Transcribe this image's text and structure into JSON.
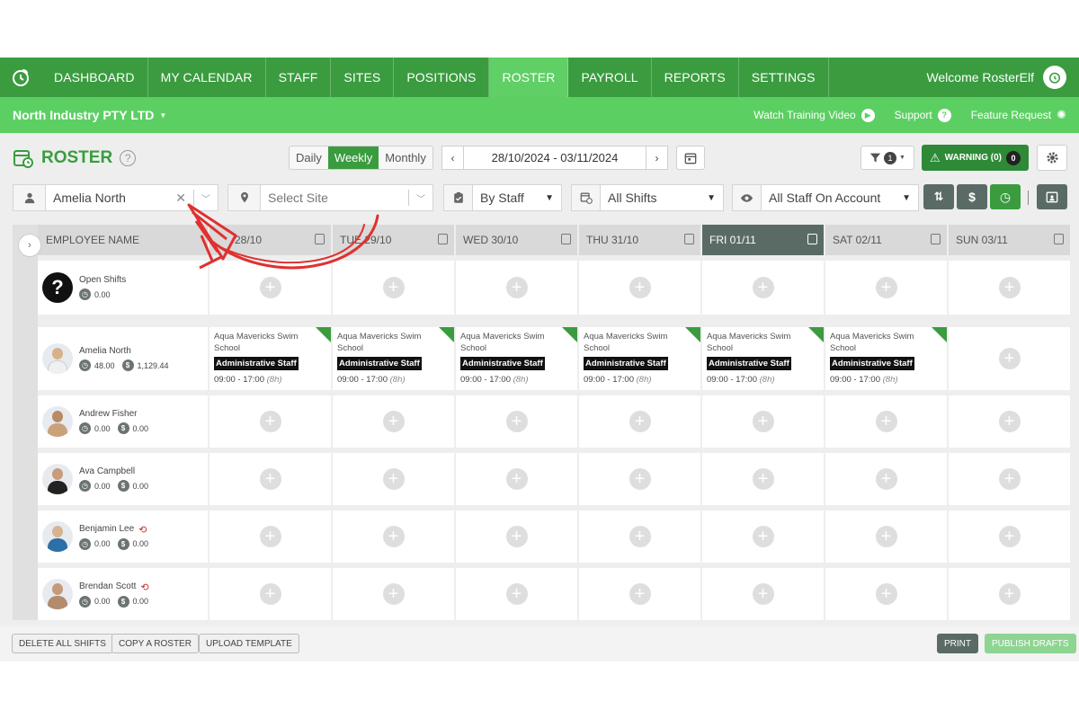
{
  "nav": {
    "items": [
      "DASHBOARD",
      "MY CALENDAR",
      "STAFF",
      "SITES",
      "POSITIONS",
      "ROSTER",
      "PAYROLL",
      "REPORTS",
      "SETTINGS"
    ],
    "active": "ROSTER",
    "welcome": "Welcome RosterElf"
  },
  "subbar": {
    "company": "North Industry PTY LTD",
    "watch": "Watch Training Video",
    "support": "Support",
    "feature": "Feature Request"
  },
  "roster": {
    "title": "ROSTER",
    "views": [
      "Daily",
      "Weekly",
      "Monthly"
    ],
    "active_view": "Weekly",
    "date_range": "28/10/2024 - 03/11/2024",
    "filter_count": "1",
    "warning_label": "WARNING (0)",
    "warning_count": "0"
  },
  "filters": {
    "employee": "Amelia North",
    "site_placeholder": "Select Site",
    "group_by": "By Staff",
    "shifts": "All Shifts",
    "visibility": "All Staff On Account"
  },
  "grid": {
    "employee_header": "EMPLOYEE NAME",
    "days": [
      "MON 28/10",
      "TUE 29/10",
      "WED 30/10",
      "THU 31/10",
      "FRI 01/11",
      "SAT 02/11",
      "SUN 03/11"
    ],
    "visible_days": [
      "28/10",
      "TUE 29/10",
      "WED 30/10",
      "THU 31/10",
      "FRI 01/11",
      "SAT 02/11",
      "SUN 03/11"
    ],
    "today_index": 4,
    "rows": [
      {
        "name": "Open Shifts",
        "hours": "0.00",
        "cost": ""
      },
      {
        "name": "Amelia North",
        "hours": "48.00",
        "cost": "1,129.44"
      },
      {
        "name": "Andrew Fisher",
        "hours": "0.00",
        "cost": "0.00"
      },
      {
        "name": "Ava Campbell",
        "hours": "0.00",
        "cost": "0.00"
      },
      {
        "name": "Benjamin Lee",
        "hours": "0.00",
        "cost": "0.00"
      },
      {
        "name": "Brendan Scott",
        "hours": "0.00",
        "cost": "0.00"
      }
    ],
    "shift": {
      "site_line1": "Aqua Mavericks Swim",
      "site_line2": "School",
      "position": "Administrative Staff",
      "time": "09:00 - 17:00",
      "duration": "(8h)"
    }
  },
  "bottom": {
    "delete": "DELETE ALL SHIFTS",
    "copy": "COPY A ROSTER",
    "upload": "UPLOAD TEMPLATE",
    "print": "PRINT",
    "publish": "PUBLISH DRAFTS"
  },
  "colors": {
    "nav_green": "#3a9c3f",
    "sub_green": "#5ccf63",
    "annotation_red": "#e03030"
  }
}
